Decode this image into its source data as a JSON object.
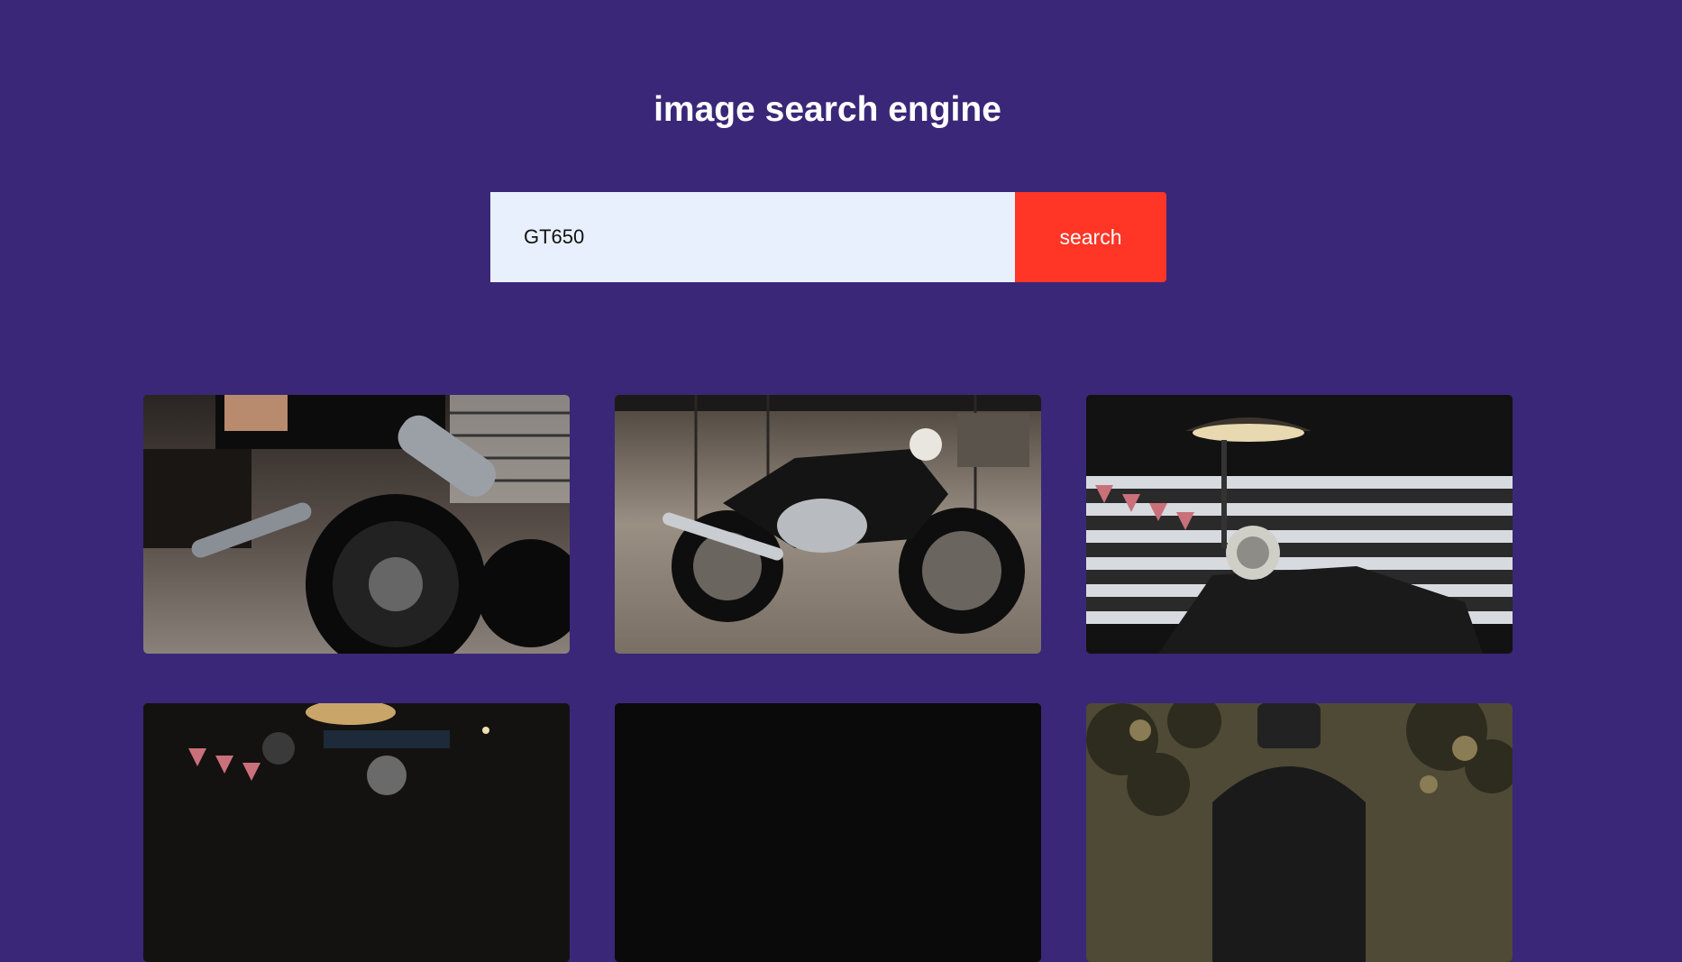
{
  "header": {
    "title": "image search engine"
  },
  "search": {
    "value": "GT650",
    "button_label": "search"
  },
  "results": [
    {
      "subject": "motorcycle rear wheel and exhaust in showroom"
    },
    {
      "subject": "motorcycle in showroom"
    },
    {
      "subject": "motorcycle under hanging lamp with bunting"
    },
    {
      "subject": "motorcycle under hanging lamp"
    },
    {
      "subject": "dark image"
    },
    {
      "subject": "rider in helmet among foliage"
    }
  ],
  "colors": {
    "background": "#3a2778",
    "title": "#ffffff",
    "input_bg": "#e8f0fd",
    "button_bg": "#ff3526"
  }
}
